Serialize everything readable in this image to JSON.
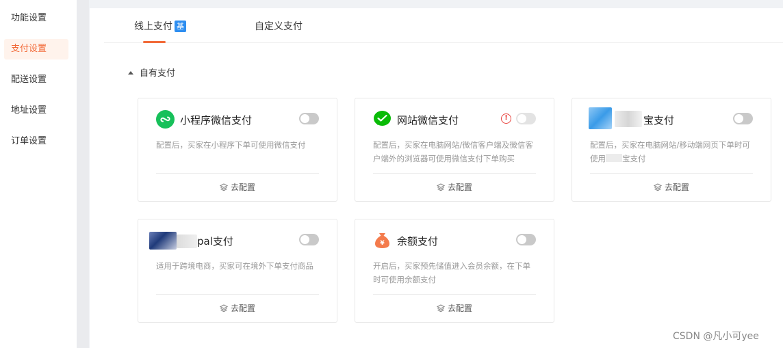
{
  "sidebar": {
    "items": [
      {
        "label": "功能设置"
      },
      {
        "label": "支付设置",
        "active": true
      },
      {
        "label": "配送设置"
      },
      {
        "label": "地址设置"
      },
      {
        "label": "订单设置"
      }
    ]
  },
  "tabs": [
    {
      "label": "线上支付",
      "badge": "基",
      "active": true
    },
    {
      "label": "自定义支付"
    }
  ],
  "section": {
    "title": "自有支付",
    "expanded": true
  },
  "cards": [
    {
      "title": "小程序微信支付",
      "desc": "配置后，买家在小程序下单可使用微信支付",
      "action": "去配置",
      "icon": "mini-program-wechat-icon",
      "enabled": false
    },
    {
      "title": "网站微信支付",
      "desc": "配置后，买家在电脑网站/微信客户端及微信客户端外的浏览器可使用微信支付下单购买",
      "action": "去配置",
      "icon": "wechat-pay-icon",
      "enabled": false,
      "warning": "!"
    },
    {
      "title": "宝支付",
      "desc_before": "配置后，买家在电脑网站/移动端网页下单时可使用",
      "desc_after": "宝支付",
      "action": "去配置",
      "icon": "alipay-icon",
      "enabled": false
    },
    {
      "title": "pal支付",
      "desc": "适用于跨境电商，买家可在境外下单支付商品",
      "action": "去配置",
      "icon": "paypal-icon",
      "enabled": false
    },
    {
      "title": "余额支付",
      "desc": "开启后，买家预先储值进入会员余额，在下单时可使用余额支付",
      "action": "去配置",
      "icon": "money-bag-icon",
      "enabled": false
    }
  ],
  "watermark": "CSDN @凡小可yee",
  "colors": {
    "accent": "#f26b3a",
    "badge": "#2e8ef0",
    "wechat": "#09bb07",
    "warning": "#e8443f"
  }
}
